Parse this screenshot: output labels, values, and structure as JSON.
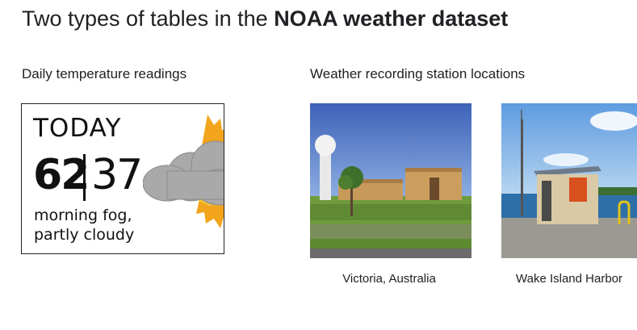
{
  "slide": {
    "title_prefix": "Two types of tables in the ",
    "title_bold": "NOAA weather dataset"
  },
  "left_section": {
    "heading": "Daily temperature readings",
    "card": {
      "day": "TODAY",
      "high": "62",
      "low": "37",
      "description_line1": "morning fog,",
      "description_line2": "partly cloudy",
      "icon": "sun-behind-cloud-icon"
    }
  },
  "right_section": {
    "heading": "Weather recording station locations",
    "stations": [
      {
        "caption": "Victoria, Australia"
      },
      {
        "caption": "Wake Island Harbor"
      }
    ]
  }
}
